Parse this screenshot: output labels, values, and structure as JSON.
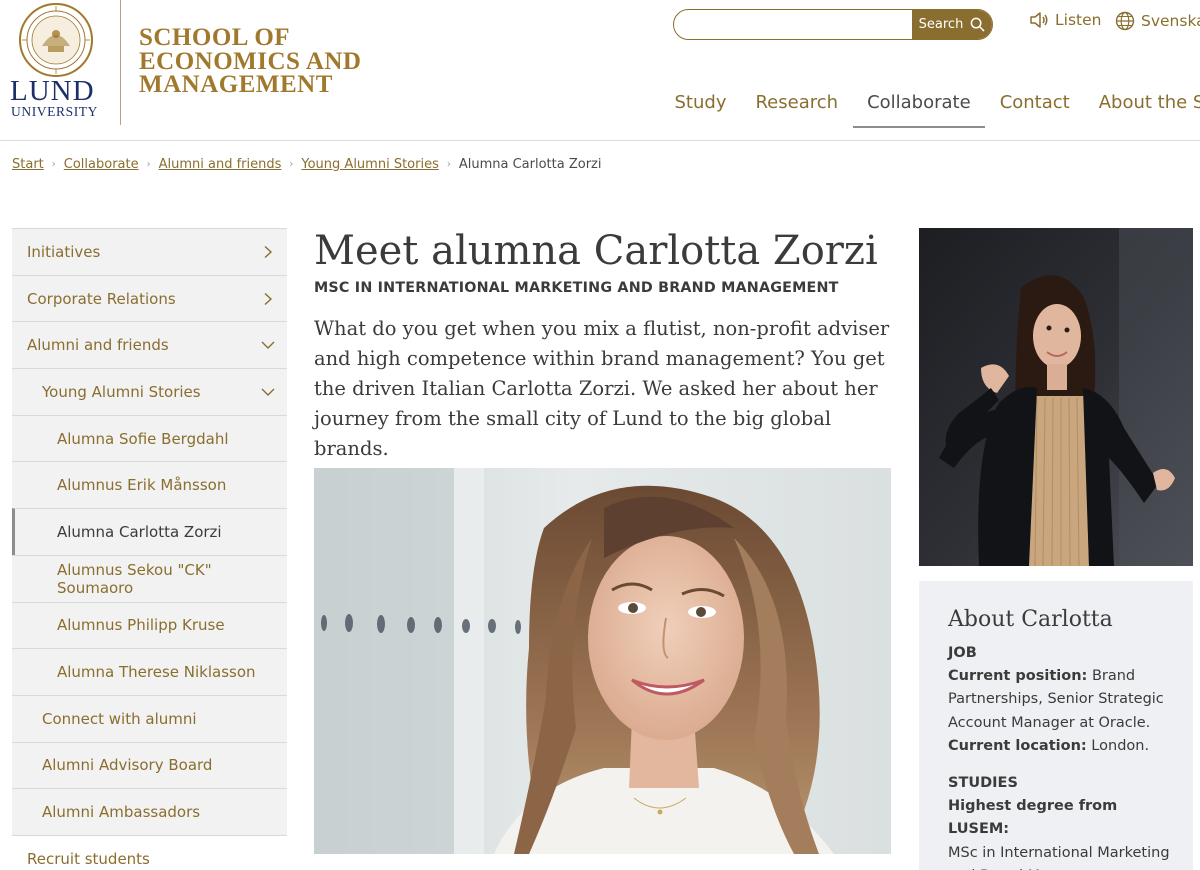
{
  "header": {
    "logo": {
      "wordmark_main": "LUND",
      "wordmark_sub": "UNIVERSITY"
    },
    "school_name_lines": [
      "SCHOOL OF",
      "ECONOMICS AND",
      "MANAGEMENT"
    ],
    "search": {
      "placeholder": "",
      "button_label": "Search"
    },
    "listen_label": "Listen",
    "language_label": "Svenska",
    "colors": {
      "brand_gold": "#8a6e2f",
      "school_gold": "#a0792c",
      "lund_blue": "#1c2f6b"
    }
  },
  "nav": {
    "items": [
      {
        "label": "Study"
      },
      {
        "label": "Research"
      },
      {
        "label": "Collaborate"
      },
      {
        "label": "Contact"
      },
      {
        "label": "About the School"
      }
    ],
    "active": "Collaborate"
  },
  "breadcrumb": {
    "items": [
      "Start",
      "Collaborate",
      "Alumni and friends",
      "Young Alumni Stories"
    ],
    "current": "Alumna Carlotta Zorzi"
  },
  "sidebar": {
    "items": [
      {
        "label": "Initiatives",
        "level": 0,
        "chevron": "right"
      },
      {
        "label": "Corporate Relations",
        "level": 0,
        "chevron": "right"
      },
      {
        "label": "Alumni and friends",
        "level": 0,
        "chevron": "down"
      },
      {
        "label": "Young Alumni Stories",
        "level": 1,
        "chevron": "down"
      },
      {
        "label": "Alumna Sofie Bergdahl",
        "level": 2
      },
      {
        "label": "Alumnus Erik Månsson",
        "level": 2
      },
      {
        "label": "Alumna Carlotta Zorzi",
        "level": 2,
        "current": true
      },
      {
        "label": "Alumnus Sekou \"CK\" Soumaoro",
        "level": 2
      },
      {
        "label": "Alumnus Philipp Kruse",
        "level": 2
      },
      {
        "label": "Alumna Therese Niklasson",
        "level": 2
      },
      {
        "label": "Connect with alumni",
        "level": 1
      },
      {
        "label": "Alumni Advisory Board",
        "level": 1
      },
      {
        "label": "Alumni Ambassadors",
        "level": 1
      },
      {
        "label": "Recruit students",
        "level": 0,
        "plain": true
      }
    ]
  },
  "article": {
    "title": "Meet alumna Carlotta Zorzi",
    "program": "MSC IN INTERNATIONAL MARKETING AND BRAND MANAGEMENT",
    "lead": "What do you get when you mix a flutist, non-profit adviser and high competence within brand management? You get the driven Italian Carlotta Zorzi. We asked her about her journey from the small city of Lund to the big global brands."
  },
  "factbox": {
    "title": "About Carlotta",
    "job_heading": "JOB",
    "current_position_label": "Current position:",
    "current_position_value": " Brand Partnerships, Senior Strategic Account Manager at Oracle.",
    "current_location_label": "Current location:",
    "current_location_value": " London.",
    "studies_heading": "STUDIES",
    "highest_degree_label": "Highest degree from LUSEM:",
    "highest_degree_value": "MSc in International Marketing and Brand Management."
  }
}
